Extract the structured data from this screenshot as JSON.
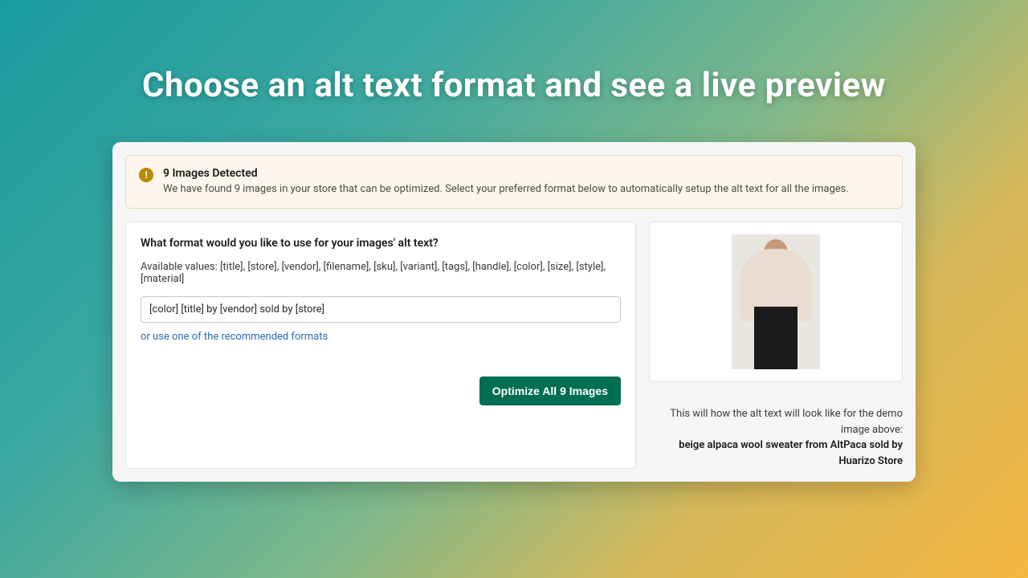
{
  "hero": {
    "title": "Choose an alt text format and see a live preview"
  },
  "notice": {
    "title": "9 Images Detected",
    "text": "We have found 9 images in your store that can be optimized. Select your preferred format below to automatically setup the alt text for all the images."
  },
  "format": {
    "question": "What format would you like to use for your images' alt text?",
    "available_label": "Available values: [title], [store], [vendor], [filename], [sku], [variant], [tags], [handle], [color], [size], [style], [material]",
    "input_value": "[color] [title] by [vendor] sold by [store]",
    "recommended_link": "or use one of the recommended formats",
    "optimize_button": "Optimize All 9 Images"
  },
  "preview": {
    "caption_lead": "This will how the alt text will look like for the demo image above:",
    "caption_result": "beige alpaca wool sweater from AltPaca sold by Huarizo Store"
  }
}
